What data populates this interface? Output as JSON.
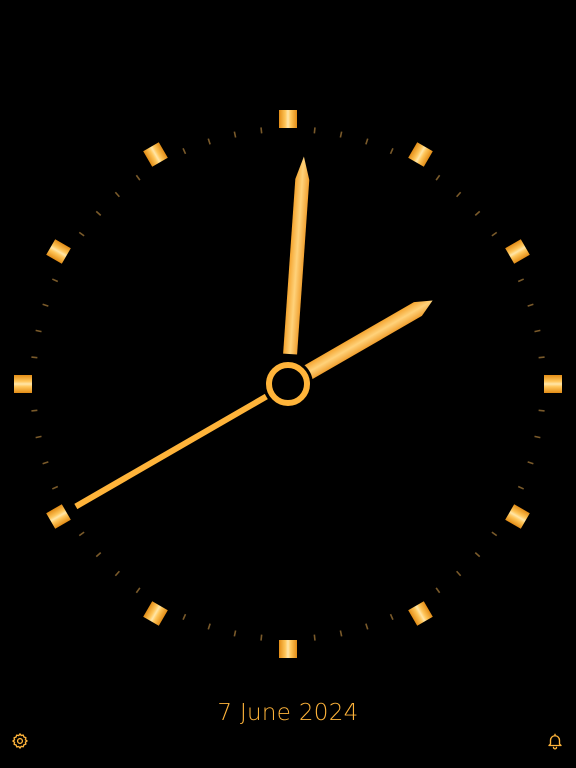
{
  "clock": {
    "time": {
      "hour": 2,
      "minute": 0,
      "second": 40
    },
    "colors": {
      "background": "#000000",
      "accent": "#FFB43A",
      "accent_light": "#FFD98A",
      "accent_dark": "#E08A14",
      "minor_tick": "#7A5A2A"
    }
  },
  "date": {
    "label": "7 June 2024"
  },
  "buttons": {
    "settings_icon": "gear-icon",
    "alarm_icon": "bell-icon"
  }
}
